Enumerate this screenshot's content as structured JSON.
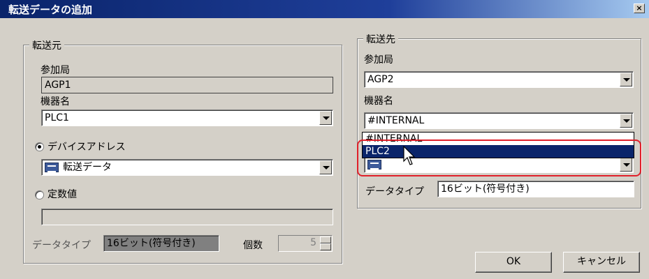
{
  "window": {
    "title": "転送データの追加",
    "close_label": "×"
  },
  "source": {
    "group_label": "転送元",
    "station_label": "参加局",
    "station_value": "AGP1",
    "device_label": "機器名",
    "device_value": "PLC1",
    "radio_device_address": "デバイスアドレス",
    "device_address_value": "転送データ",
    "radio_constant": "定数値",
    "constant_value": "",
    "data_type_label": "データタイプ",
    "data_type_value": "16ビット(符号付き)",
    "count_label": "個数",
    "count_value": "5"
  },
  "destination": {
    "group_label": "転送先",
    "station_label": "参加局",
    "station_value": "AGP2",
    "device_label": "機器名",
    "device_value": "#INTERNAL",
    "dropdown_options": [
      "#INTERNAL",
      "PLC2"
    ],
    "selected_option": "PLC2",
    "data_type_label": "データタイプ",
    "data_type_value": "16ビット(符号付き)"
  },
  "buttons": {
    "ok": "OK",
    "cancel": "キャンセル"
  },
  "colors": {
    "title_bar": "#0a246a",
    "highlight": "#e0202a",
    "dialog_bg": "#d4d0c8"
  }
}
